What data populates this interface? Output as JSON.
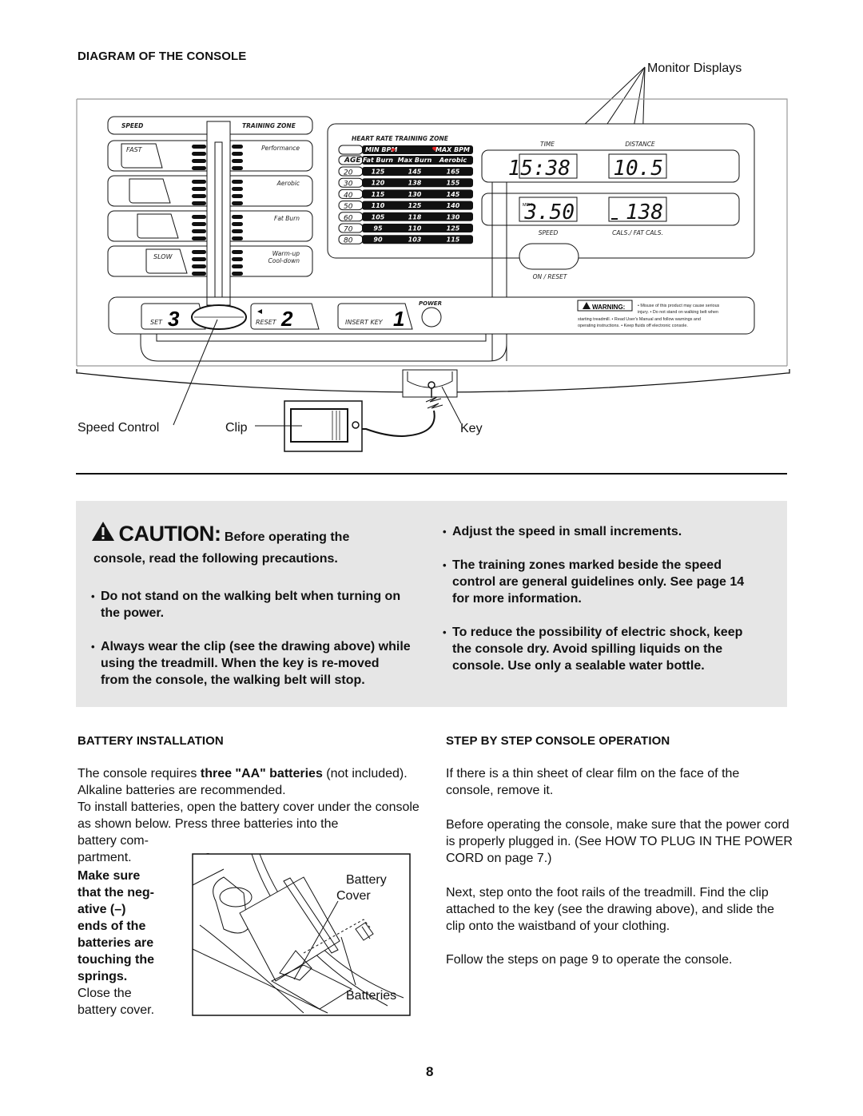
{
  "diagram": {
    "heading": "DIAGRAM OF THE CONSOLE",
    "callouts": {
      "monitor_displays": "Monitor Displays",
      "speed_control": "Speed Control",
      "clip": "Clip",
      "key": "Key"
    },
    "speed_panel": {
      "speed_header": "SPEED",
      "zone_header": "TRAINING ZONE",
      "fast": "FAST",
      "slow": "SLOW",
      "zones": [
        "Performance",
        "Aerobic",
        "Fat Burn",
        "Warm-up",
        "Cool-down"
      ]
    },
    "heart_rate": {
      "title": "HEART RATE TRAINING ZONE",
      "min_bpm": "MIN BPM",
      "max_bpm": "MAX BPM",
      "columns": [
        "AGE",
        "Fat Burn",
        "Max Burn",
        "Aerobic"
      ],
      "rows": [
        [
          "20",
          "125",
          "145",
          "165"
        ],
        [
          "30",
          "120",
          "138",
          "155"
        ],
        [
          "40",
          "115",
          "130",
          "145"
        ],
        [
          "50",
          "110",
          "125",
          "140"
        ],
        [
          "60",
          "105",
          "118",
          "130"
        ],
        [
          "70",
          "95",
          "110",
          "125"
        ],
        [
          "80",
          "90",
          "103",
          "115"
        ]
      ]
    },
    "monitor": {
      "time_label": "TIME",
      "time_value": "15:38",
      "distance_label": "DISTANCE",
      "distance_value": "10.5",
      "speed_label": "SPEED",
      "speed_unit": "MPH",
      "speed_value": "3.50",
      "cals_label": "CALS./ FAT CALS.",
      "cals_value": "138",
      "on_reset": "ON / RESET"
    },
    "steps": {
      "set_label": "SET",
      "set_num": "3",
      "reset_label": "RESET",
      "reset_num": "2",
      "insert_label": "INSERT KEY",
      "insert_num": "1",
      "power_label": "POWER"
    },
    "warning": {
      "badge": "WARNING:",
      "lines": [
        "• Misuse of this product may cause serious",
        "injury.  • Do not stand on walking belt when",
        "starting treadmill.  • Read User's Manual and follow warnings and",
        "operating instructions.  • Keep fluids off electronic console."
      ]
    }
  },
  "caution": {
    "title": "CAUTION:",
    "lead_inline": "Before operating the",
    "lead_rest": "console, read the following precautions.",
    "left_bullets": [
      "Do not stand on the walking belt when turning on the power.",
      "Always wear the clip (see the drawing above) while using the treadmill. When the key is re-moved from the console, the walking belt will stop."
    ],
    "right_bullets": [
      "Adjust the speed in small increments.",
      "The training zones marked beside the speed control are general guidelines only. See page 14 for more information.",
      "To reduce the possibility of electric shock, keep the console dry. Avoid spilling liquids on the console. Use only a sealable water bottle."
    ]
  },
  "battery": {
    "heading": "BATTERY INSTALLATION",
    "p1_a": "The console requires ",
    "p1_bold": "three \"AA\" batteries",
    "p1_b": " (not included). Alkaline batteries are recommended.",
    "p2": "To install batteries, open the battery cover under the console as shown below. Press three batteries into the",
    "p2_tail_lines": [
      "battery com-",
      "partment."
    ],
    "bold_lines": [
      "Make sure",
      "that the neg-",
      "ative (–)",
      "ends of the",
      "batteries are",
      "touching the",
      "springs."
    ],
    "close_lines": [
      "Close the",
      "battery cover."
    ],
    "figure_labels": {
      "cover": [
        "Battery",
        "Cover"
      ],
      "batteries": "Batteries"
    }
  },
  "operation": {
    "heading": "STEP BY STEP CONSOLE OPERATION",
    "paragraphs": [
      "If there is a thin sheet of clear film on the face of the console, remove it.",
      "Before operating the console, make sure that the power cord is properly plugged in. (See HOW TO PLUG IN THE POWER CORD on page 7.)",
      "Next, step onto the foot rails of the treadmill. Find the clip attached to the key (see the drawing above), and slide the clip onto the waistband of your clothing.",
      "Follow the steps on page 9 to operate the console."
    ]
  },
  "page_number": "8"
}
